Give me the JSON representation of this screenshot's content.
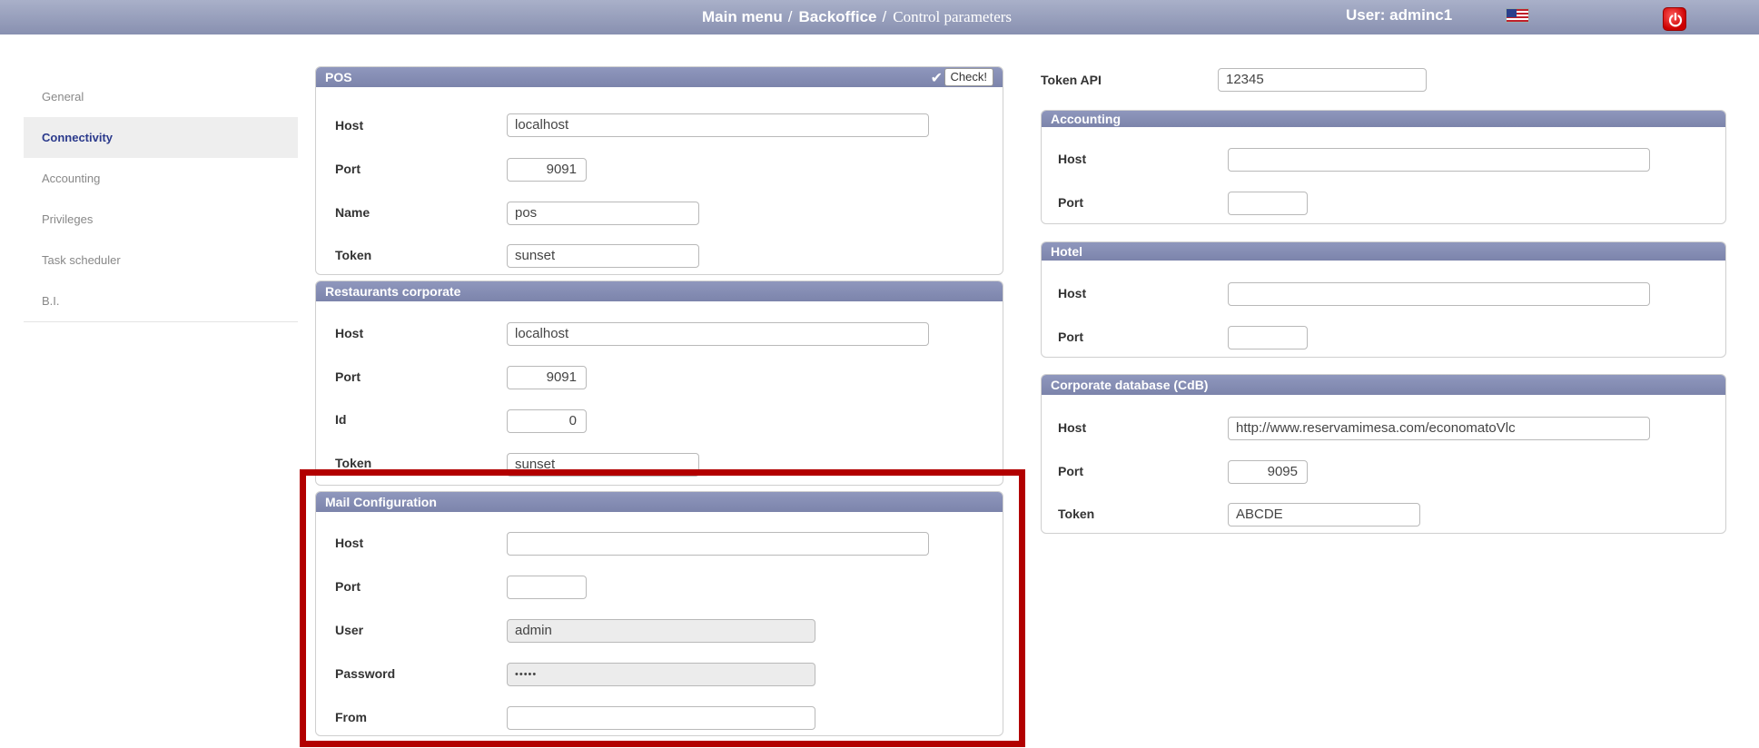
{
  "header": {
    "crumb_main": "Main menu",
    "crumb_backoffice": "Backoffice",
    "crumb_current": "Control parameters",
    "sep": "/",
    "user_label": "User: adminc1",
    "flag_icon": "us-flag-icon",
    "power_icon": "power-icon"
  },
  "sidebar": {
    "items": [
      {
        "label": "General"
      },
      {
        "label": "Connectivity"
      },
      {
        "label": "Accounting"
      },
      {
        "label": "Privileges"
      },
      {
        "label": "Task scheduler"
      },
      {
        "label": "B.I."
      }
    ],
    "active": "Connectivity"
  },
  "pos": {
    "title": "POS",
    "check_label": "Check!",
    "host_label": "Host",
    "host_value": "localhost",
    "port_label": "Port",
    "port_value": "9091",
    "name_label": "Name",
    "name_value": "pos",
    "token_label": "Token",
    "token_value": "sunset"
  },
  "restaurants": {
    "title": "Restaurants corporate",
    "host_label": "Host",
    "host_value": "localhost",
    "port_label": "Port",
    "port_value": "9091",
    "id_label": "Id",
    "id_value": "0",
    "token_label": "Token",
    "token_value": "sunset"
  },
  "mail": {
    "title": "Mail Configuration",
    "host_label": "Host",
    "host_value": "",
    "port_label": "Port",
    "port_value": "",
    "user_label": "User",
    "user_value": "admin",
    "password_label": "Password",
    "password_value": "•••••",
    "from_label": "From",
    "from_value": ""
  },
  "token_api": {
    "label": "Token API",
    "value": "12345"
  },
  "accounting": {
    "title": "Accounting",
    "host_label": "Host",
    "host_value": "",
    "port_label": "Port",
    "port_value": ""
  },
  "hotel": {
    "title": "Hotel",
    "host_label": "Host",
    "host_value": "",
    "port_label": "Port",
    "port_value": ""
  },
  "cdb": {
    "title": "Corporate database (CdB)",
    "host_label": "Host",
    "host_value": "http://www.reservamimesa.com/economatoVlc",
    "port_label": "Port",
    "port_value": "9095",
    "token_label": "Token",
    "token_value": "ABCDE"
  },
  "colors": {
    "header_bar": "#8890b0",
    "panel_header": "#7c84ab",
    "active_item": "#2b3a8c",
    "highlight": "#b20000"
  }
}
